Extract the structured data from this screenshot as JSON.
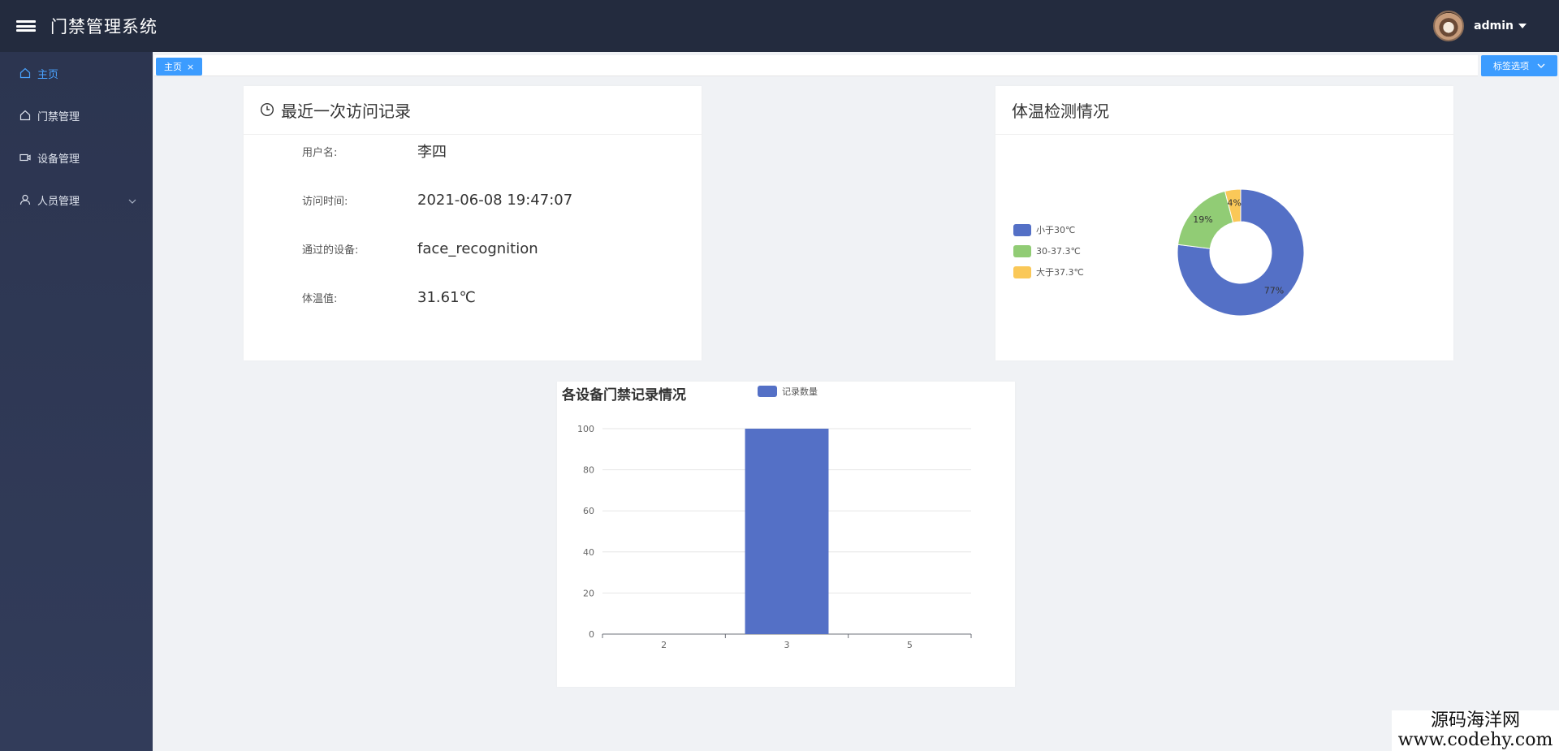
{
  "header": {
    "app_title": "门禁管理系统",
    "user_name": "admin"
  },
  "sidebar": {
    "items": [
      {
        "label": "主页",
        "icon": "home-icon",
        "active": true
      },
      {
        "label": "门禁管理",
        "icon": "home-icon",
        "active": false
      },
      {
        "label": "设备管理",
        "icon": "camera-icon",
        "active": false
      },
      {
        "label": "人员管理",
        "icon": "user-icon",
        "active": false,
        "expandable": true
      }
    ]
  },
  "tabs": {
    "home_tag": "主页",
    "close_glyph": "×",
    "options_label": "标签选项"
  },
  "visit_card": {
    "title": "最近一次访问记录",
    "fields": [
      {
        "label": "用户名:",
        "value": "李四"
      },
      {
        "label": "访问时间:",
        "value": "2021-06-08 19:47:07"
      },
      {
        "label": "通过的设备:",
        "value": "face_recognition"
      },
      {
        "label": "体温值:",
        "value": "31.61℃"
      }
    ]
  },
  "temp_card": {
    "title": "体温检测情况"
  },
  "bar_card": {
    "title": "各设备门禁记录情况"
  },
  "chart_data": [
    {
      "type": "pie",
      "variant": "donut",
      "labels": [
        "小于30℃",
        "30-37.3℃",
        "大于37.3℃"
      ],
      "values": [
        77,
        19,
        4
      ],
      "value_labels": [
        "77%",
        "19%",
        "4%"
      ],
      "colors": [
        "#5470c6",
        "#91cc75",
        "#fac858"
      ],
      "legend_position": "left"
    },
    {
      "type": "bar",
      "categories": [
        "2",
        "3",
        "5"
      ],
      "series": [
        {
          "name": "记录数量",
          "values": [
            0,
            100,
            0
          ],
          "color": "#5470c6"
        }
      ],
      "ylim": [
        0,
        100
      ],
      "yticks": [
        0,
        20,
        40,
        60,
        80,
        100
      ],
      "grid": true,
      "legend_position": "top"
    }
  ],
  "watermark": {
    "line1": "源码海洋网",
    "line2": "www.codehy.com"
  }
}
